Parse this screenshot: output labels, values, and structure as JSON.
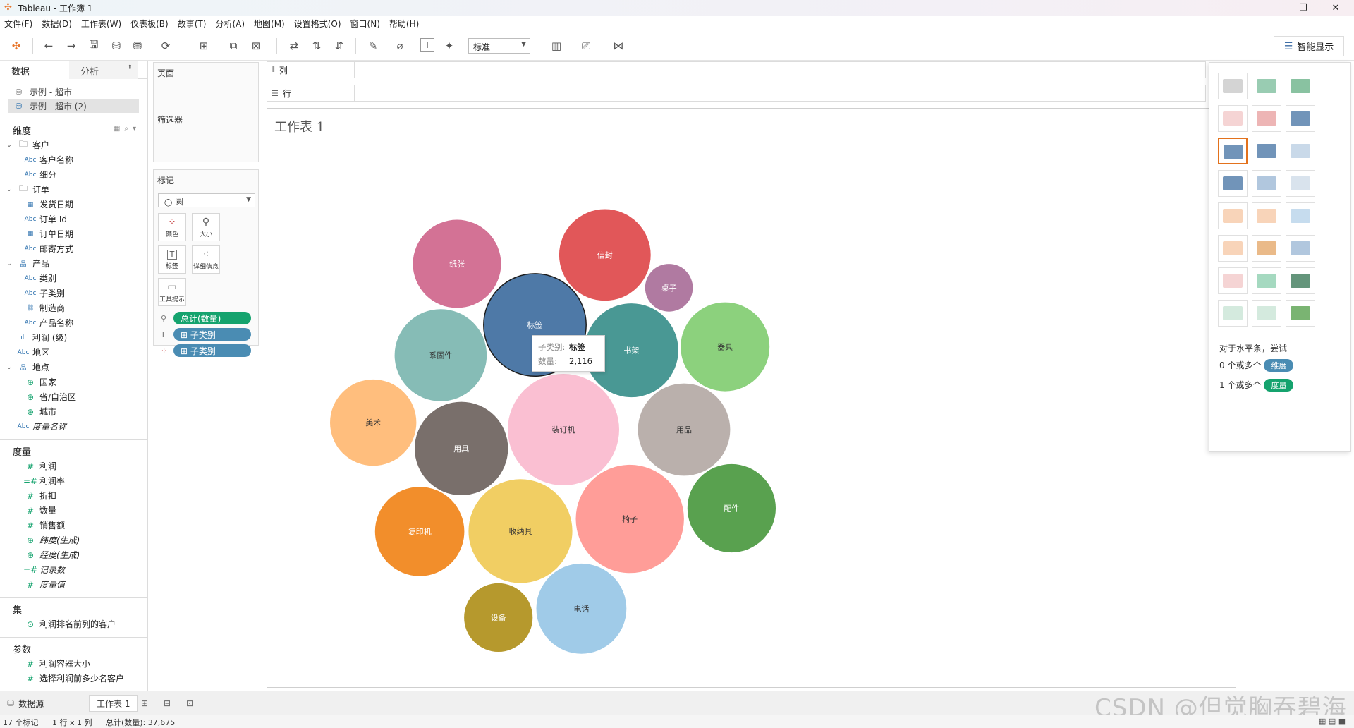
{
  "window": {
    "title": "Tableau - 工作簿 1",
    "minimize": "—",
    "maximize": "❐",
    "close": "✕"
  },
  "menu": [
    "文件(F)",
    "数据(D)",
    "工作表(W)",
    "仪表板(B)",
    "故事(T)",
    "分析(A)",
    "地图(M)",
    "设置格式(O)",
    "窗口(N)",
    "帮助(H)"
  ],
  "toolbar": {
    "fit_value": "标准",
    "smart_show_label": "智能显示"
  },
  "data_pane": {
    "tabs": [
      "数据",
      "分析"
    ],
    "sources": [
      "示例 - 超市",
      "示例 - 超市 (2)"
    ],
    "dimensions_title": "维度",
    "dimensions": [
      {
        "label": "客户",
        "kind": "folder",
        "level": 0
      },
      {
        "label": "客户名称",
        "kind": "abc",
        "level": 1
      },
      {
        "label": "细分",
        "kind": "abc",
        "level": 1
      },
      {
        "label": "订单",
        "kind": "folder",
        "level": 0
      },
      {
        "label": "发货日期",
        "kind": "date",
        "level": 1
      },
      {
        "label": "订单 Id",
        "kind": "abc",
        "level": 1
      },
      {
        "label": "订单日期",
        "kind": "date",
        "level": 1
      },
      {
        "label": "邮寄方式",
        "kind": "abc",
        "level": 1
      },
      {
        "label": "产品",
        "kind": "hier",
        "level": 0
      },
      {
        "label": "类别",
        "kind": "abc",
        "level": 1
      },
      {
        "label": "子类别",
        "kind": "abc",
        "level": 1
      },
      {
        "label": "制造商",
        "kind": "link",
        "level": 1
      },
      {
        "label": "产品名称",
        "kind": "abc",
        "level": 1
      },
      {
        "label": "利润 (级)",
        "kind": "bin",
        "level": 0
      },
      {
        "label": "地区",
        "kind": "abc",
        "level": 0
      },
      {
        "label": "地点",
        "kind": "hier",
        "level": 0
      },
      {
        "label": "国家",
        "kind": "geo",
        "level": 1
      },
      {
        "label": "省/自治区",
        "kind": "geo",
        "level": 1
      },
      {
        "label": "城市",
        "kind": "geo",
        "level": 1
      },
      {
        "label": "度量名称",
        "kind": "abc",
        "level": 0,
        "italic": true
      }
    ],
    "measures_title": "度量",
    "measures": [
      {
        "label": "利润",
        "kind": "num"
      },
      {
        "label": "利润率",
        "kind": "calc"
      },
      {
        "label": "折扣",
        "kind": "num"
      },
      {
        "label": "数量",
        "kind": "num"
      },
      {
        "label": "销售额",
        "kind": "num"
      },
      {
        "label": "纬度(生成)",
        "kind": "geo",
        "italic": true
      },
      {
        "label": "经度(生成)",
        "kind": "geo",
        "italic": true
      },
      {
        "label": "记录数",
        "kind": "calc",
        "italic": true
      },
      {
        "label": "度量值",
        "kind": "num",
        "italic": true
      }
    ],
    "sets_title": "集",
    "sets": [
      {
        "label": "利润排名前列的客户",
        "kind": "set"
      }
    ],
    "params_title": "参数",
    "params": [
      {
        "label": "利润容器大小",
        "kind": "num"
      },
      {
        "label": "选择利润前多少名客户",
        "kind": "num"
      }
    ]
  },
  "cards": {
    "pages_title": "页面",
    "filters_title": "筛选器",
    "marks_title": "标记",
    "mark_type": "圆",
    "mark_buttons": [
      "颜色",
      "大小",
      "标签",
      "详细信息",
      "工具提示"
    ],
    "pills": [
      {
        "enc": "size",
        "label": "总计(数量)",
        "color": "green"
      },
      {
        "enc": "label",
        "label": "⊞ 子类别",
        "color": "blue"
      },
      {
        "enc": "color",
        "label": "⊞ 子类别",
        "color": "blue"
      }
    ]
  },
  "shelves": {
    "columns": "列",
    "rows": "行"
  },
  "sheet": {
    "title": "工作表 1"
  },
  "chart_data": {
    "type": "packed-bubble",
    "title": "工作表 1",
    "size_measure": "总计(数量)",
    "label_dimension": "子类别",
    "color_dimension": "子类别",
    "series": [
      {
        "name": "用具",
        "value": 1755,
        "color": "#796f6b"
      },
      {
        "name": "椅子",
        "value": 2356,
        "color": "#ff9d98"
      },
      {
        "name": "收纳具",
        "value": 2169,
        "color": "#f1ce63"
      },
      {
        "name": "器具",
        "value": 1591,
        "color": "#8cd17d"
      },
      {
        "name": "设备",
        "value": 946,
        "color": "#b6992d"
      },
      {
        "name": "桌子",
        "value": 456,
        "color": "#b07aa1"
      },
      {
        "name": "书架",
        "value": 1769,
        "color": "#499894"
      },
      {
        "name": "配件",
        "value": 1570,
        "color": "#59a14f"
      },
      {
        "name": "标签",
        "value": 2116,
        "color": "#4e79a7",
        "highlight": true
      },
      {
        "name": "电话",
        "value": 1635,
        "color": "#a0cbe8"
      },
      {
        "name": "系固件",
        "value": 1708,
        "color": "#86bcb6"
      },
      {
        "name": "装订机",
        "value": 2498,
        "color": "#fabfd2"
      },
      {
        "name": "美术",
        "value": 1497,
        "color": "#ffbe7d"
      },
      {
        "name": "复印机",
        "value": 1606,
        "color": "#f28e2b"
      },
      {
        "name": "信封",
        "value": 1686,
        "color": "#e15759"
      },
      {
        "name": "纸张",
        "value": 1564,
        "color": "#d37295"
      },
      {
        "name": "用品",
        "value": 1713,
        "color": "#bab0ac"
      }
    ]
  },
  "tooltip": {
    "k1": "子类别:",
    "v1": "标签",
    "k2": "数量:",
    "v2": "2,116"
  },
  "showme": {
    "hint_title": "对于水平条，尝试",
    "hint_dim_prefix": "0 个或多个",
    "dim_tag": "维度",
    "hint_meas_prefix": "1 个或多个",
    "meas_tag": "度量"
  },
  "bottom": {
    "datasource_tab": "数据源",
    "sheet_tab": "工作表 1"
  },
  "status": {
    "marks": "17 个标记",
    "dims": "1 行 x 1 列",
    "sum": "总计(数量): 37,675"
  },
  "watermark": "CSDN @但觉胸吞碧海"
}
